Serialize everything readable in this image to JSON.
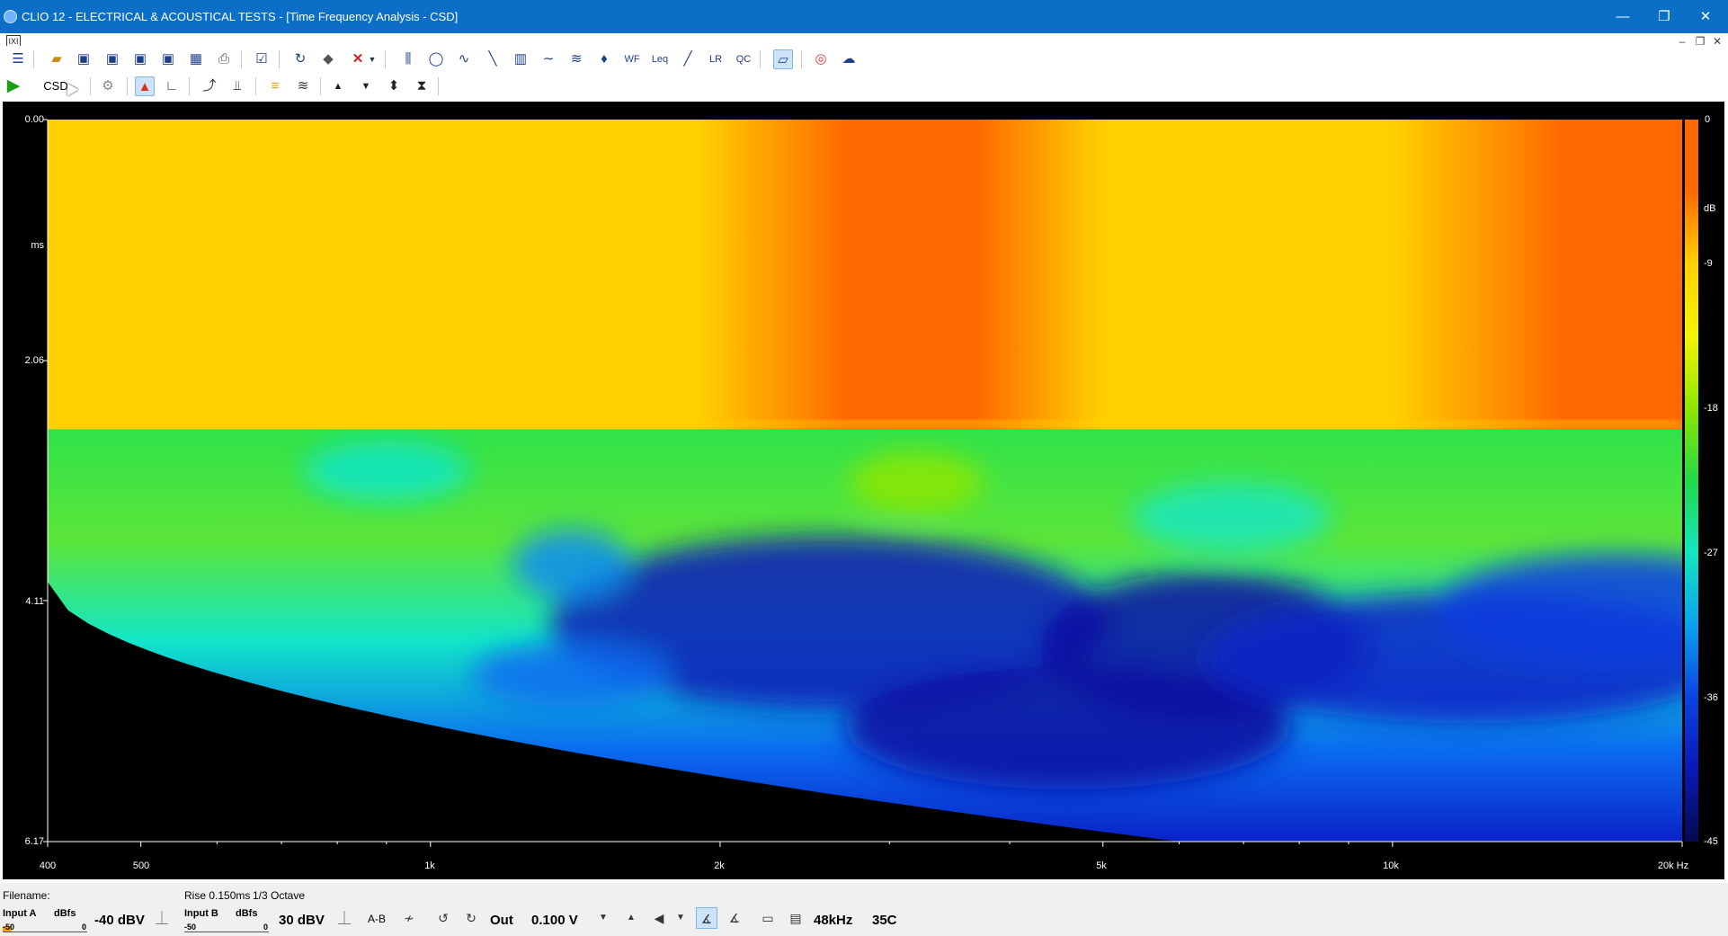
{
  "window": {
    "title": "CLIO 12 - ELECTRICAL & ACOUSTICAL TESTS - [Time Frequency Analysis - CSD]",
    "controls": [
      "—",
      "❐",
      "✕"
    ],
    "mdi_controls": [
      "–",
      "❐",
      "✕"
    ]
  },
  "toolbar1": {
    "icons": [
      "menu-icon",
      "open-folder-icon",
      "save-icon",
      "save-as-icon",
      "export-icon",
      "save-all-icon",
      "calendar-icon",
      "print-icon",
      "checklist-icon",
      "refresh-icon",
      "eraser-icon",
      "stop-icon",
      "dropdown-icon",
      "mls-icon",
      "sinusoidal-icon",
      "fft-icon",
      "measure-line-icon",
      "spectrum-icon",
      "sine-wave-icon",
      "wave-icon",
      "microphone-icon",
      "waterfall-icon",
      "leq-icon",
      "pen-icon",
      "lr-icon",
      "qc-icon",
      "ruler-icon",
      "help-lifebuoy-icon",
      "about-icon"
    ]
  },
  "toolbar2": {
    "csd_label": "CSD",
    "icons": [
      "play-icon",
      "settings-gear-icon",
      "color-map-icon",
      "axis-icon",
      "load-overlay-icon",
      "overlay-settings-icon",
      "color-scale-icon",
      "waterfall-mode-icon",
      "arrow-up-icon",
      "arrow-down-icon",
      "expand-icon",
      "compress-icon"
    ]
  },
  "chart_data": {
    "type": "heatmap",
    "title": "",
    "xlabel": "Hz",
    "ylabel": "ms",
    "x_scale": "log",
    "xlim": [
      400,
      20000
    ],
    "ylim": [
      0.0,
      6.17
    ],
    "x_ticks": [
      {
        "value": 400,
        "label": "400"
      },
      {
        "value": 500,
        "label": "500"
      },
      {
        "value": 1000,
        "label": "1k"
      },
      {
        "value": 2000,
        "label": "2k"
      },
      {
        "value": 5000,
        "label": "5k"
      },
      {
        "value": 10000,
        "label": "10k"
      },
      {
        "value": 20000,
        "label": "20k Hz"
      }
    ],
    "y_ticks": [
      {
        "value": 0.0,
        "label": "0.00"
      },
      {
        "value": 2.06,
        "label": "2.06"
      },
      {
        "value": 4.11,
        "label": "4.11"
      },
      {
        "value": 6.17,
        "label": "6.17"
      }
    ],
    "y_unit_label": "ms",
    "colorbar": {
      "unit": "dB",
      "range": [
        -45,
        0
      ],
      "ticks": [
        {
          "value": 0,
          "label": "0"
        },
        {
          "value": -9,
          "label": "-9"
        },
        {
          "value": -18,
          "label": "-18"
        },
        {
          "value": -27,
          "label": "-27"
        },
        {
          "value": -36,
          "label": "-36"
        },
        {
          "value": -45,
          "label": "-45"
        }
      ]
    },
    "energy_drop_ms": 2.6,
    "level_before_drop_db_by_freq": [
      {
        "freq": 400,
        "db": -5
      },
      {
        "freq": 600,
        "db": -5
      },
      {
        "freq": 900,
        "db": -8
      },
      {
        "freq": 1300,
        "db": -5
      },
      {
        "freq": 1900,
        "db": -6
      },
      {
        "freq": 2700,
        "db": -2
      },
      {
        "freq": 3700,
        "db": -4
      },
      {
        "freq": 5000,
        "db": -5
      },
      {
        "freq": 7300,
        "db": -7
      },
      {
        "freq": 10000,
        "db": -5
      },
      {
        "freq": 15000,
        "db": -2
      },
      {
        "freq": 20000,
        "db": -1
      }
    ]
  },
  "status": {
    "filename_label": "Filename:",
    "rise_label": "Rise 0.150ms",
    "octave_label": "1/3 Octave",
    "input_a_label": "Input A",
    "input_a_unit": "dBfs",
    "input_a_scale_min": "-50",
    "input_a_scale_max": "0",
    "input_a_range": "-40 dBV",
    "input_b_label": "Input B",
    "input_b_unit": "dBfs",
    "input_b_scale_min": "-50",
    "input_b_scale_max": "0",
    "input_b_range": "30 dBV",
    "ab_label": "A-B",
    "out_label": "Out",
    "out_level": "0.100 V",
    "sample_rate": "48kHz",
    "temperature": "35C"
  }
}
